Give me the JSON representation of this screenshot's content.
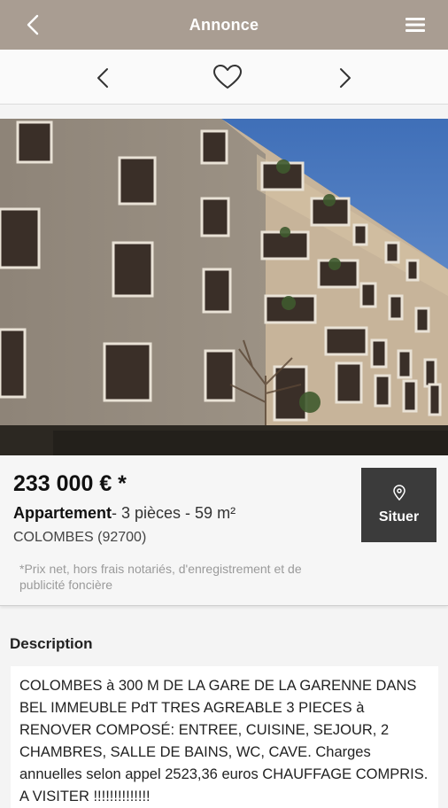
{
  "header": {
    "title": "Annonce",
    "back_icon": "chevron-left-icon",
    "menu_icon": "hamburger-menu-icon"
  },
  "navigation": {
    "prev_icon": "chevron-left-icon",
    "favorite_icon": "heart-outline-icon",
    "next_icon": "chevron-right-icon"
  },
  "listing": {
    "price": "233 000 € *",
    "type": "Appartement",
    "details": "- 3 pièces - 59 m²",
    "city": "COLOMBES (92700)",
    "note": "*Prix net, hors frais notariés, d'enregistrement et de publicité foncière",
    "locate_label": "Situer",
    "locate_icon": "map-pin-icon"
  },
  "description": {
    "title": "Description",
    "text": "COLOMBES à 300 M DE LA GARE DE LA GARENNE DANS BEL IMMEUBLE PdT TRES AGREABLE 3 PIECES à RENOVER COMPOSÉ: ENTREE, CUISINE, SEJOUR, 2 CHAMBRES, SALLE DE BAINS, WC, CAVE. Charges annuelles selon appel 2523,36 euros CHAUFFAGE COMPRIS. A VISITER !!!!!!!!!!!!!!"
  },
  "colors": {
    "header_bg": "#a99d92",
    "locate_bg": "#3b3b3b"
  }
}
